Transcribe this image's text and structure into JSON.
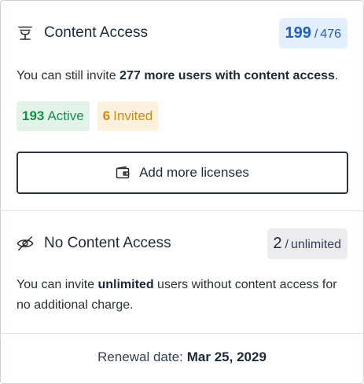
{
  "content_access": {
    "title": "Content Access",
    "icon": "content-access-icon",
    "used": "199",
    "separator": "/",
    "total": "476",
    "desc_prefix": "You can still invite ",
    "desc_bold": "277 more users with content access",
    "desc_suffix": ".",
    "active_count": "193",
    "active_label": "Active",
    "invited_count": "6",
    "invited_label": "Invited",
    "add_button_label": "Add more licenses",
    "add_button_icon": "wallet-icon"
  },
  "no_content_access": {
    "title": "No Content Access",
    "icon": "eye-off-icon",
    "used": "2",
    "separator": "/",
    "total": "unlimited",
    "desc_prefix": "You can invite ",
    "desc_bold": "unlimited",
    "desc_suffix": " users without content access for no additional charge."
  },
  "renewal": {
    "label": "Renewal date:",
    "date": "Mar 25, 2029"
  },
  "colors": {
    "blue": "#1f5fbf",
    "green": "#1e8a4b",
    "orange": "#d08a17"
  }
}
